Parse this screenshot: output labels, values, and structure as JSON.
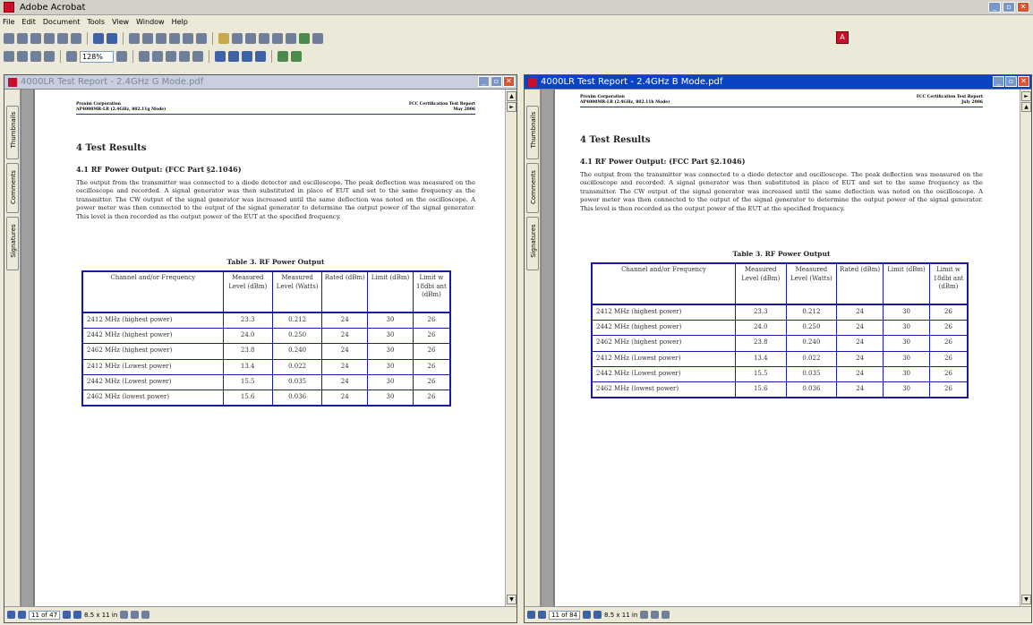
{
  "app": {
    "title": "Adobe Acrobat",
    "menus": [
      "File",
      "Edit",
      "Document",
      "Tools",
      "View",
      "Window",
      "Help"
    ],
    "zoom": "128%"
  },
  "left_doc": {
    "title": "4000LR Test Report - 2.4GHz G Mode.pdf",
    "header_left_1": "Proxim Corporation",
    "header_left_2": "AP4000MR-LR (2.4GHz, 802.11g Mode)",
    "header_right_1": "FCC Certification Test Report",
    "header_right_2": "May 2006",
    "page_status": "11 of 47",
    "page_size": "8.5 x 11 in",
    "table_rows": [
      [
        "2412 MHz (highest power)",
        "23.3",
        "0.212",
        "24",
        "30",
        "26"
      ],
      [
        "2442 MHz (highest power)",
        "24.0",
        "0.250",
        "24",
        "30",
        "26"
      ],
      [
        "2462 MHz  (highest power)",
        "23.8",
        "0.240",
        "24",
        "30",
        "26"
      ],
      [
        "2412 MHz  (Lowest power)",
        "13.4",
        "0.022",
        "24",
        "30",
        "26"
      ],
      [
        "2442 MHz (Lowest power)",
        "15.5",
        "0.035",
        "24",
        "30",
        "26"
      ],
      [
        "2462 MHz (lowest power)",
        "15.6",
        "0.036",
        "24",
        "30",
        "26"
      ]
    ]
  },
  "right_doc": {
    "title": "4000LR Test Report - 2.4GHz B Mode.pdf",
    "header_left_1": "Proxim Corporation",
    "header_left_2": "AP4000MR-LR (2.4GHz, 802.11b Mode)",
    "header_right_1": "FCC Certification Test Report",
    "header_right_2": "July 2006",
    "page_status": "11 of 84",
    "page_size": "8.5 x 11 in",
    "table_rows": [
      [
        "2412 MHz (highest power)",
        "23.3",
        "0.212",
        "24",
        "30",
        "26"
      ],
      [
        "2442 MHz (highest power)",
        "24.0",
        "0.250",
        "24",
        "30",
        "26"
      ],
      [
        "2462 MHz  (highest power)",
        "23.8",
        "0.240",
        "24",
        "30",
        "26"
      ],
      [
        "2412 MHz  (Lowest power)",
        "13.4",
        "0.022",
        "24",
        "30",
        "26"
      ],
      [
        "2442 MHz (Lowest power)",
        "15.5",
        "0.035",
        "24",
        "30",
        "26"
      ],
      [
        "2462 MHz (lowest power)",
        "15.6",
        "0.036",
        "24",
        "30",
        "26"
      ]
    ]
  },
  "content": {
    "section_heading": "4   Test Results",
    "subsection_heading": "4.1   RF Power Output: (FCC Part §2.1046)",
    "body": "The output from the transmitter was connected to a diode detector and oscilloscope. The peak deflection was measured on the oscilloscope and recorded. A signal generator was then substituted in place of EUT and set to the same frequency as the transmitter. The CW output of the signal generator was increased until the same deflection was noted on the oscilloscope. A power meter was then connected to the output of the signal generator to determine the output power of the signal generator. This level is then recorded as the output power of the EUT at the specified frequency.",
    "table_caption": "Table 3. RF Power Output",
    "col_headers": [
      "Channel and/or Frequency",
      "Measured Level (dBm)",
      "Measured Level (Watts)",
      "Rated (dBm)",
      "Limit (dBm)",
      "Limit w 18dbi ant (dBm)"
    ]
  },
  "nav_tabs": [
    "Thumbnails",
    "Comments",
    "Signatures"
  ]
}
